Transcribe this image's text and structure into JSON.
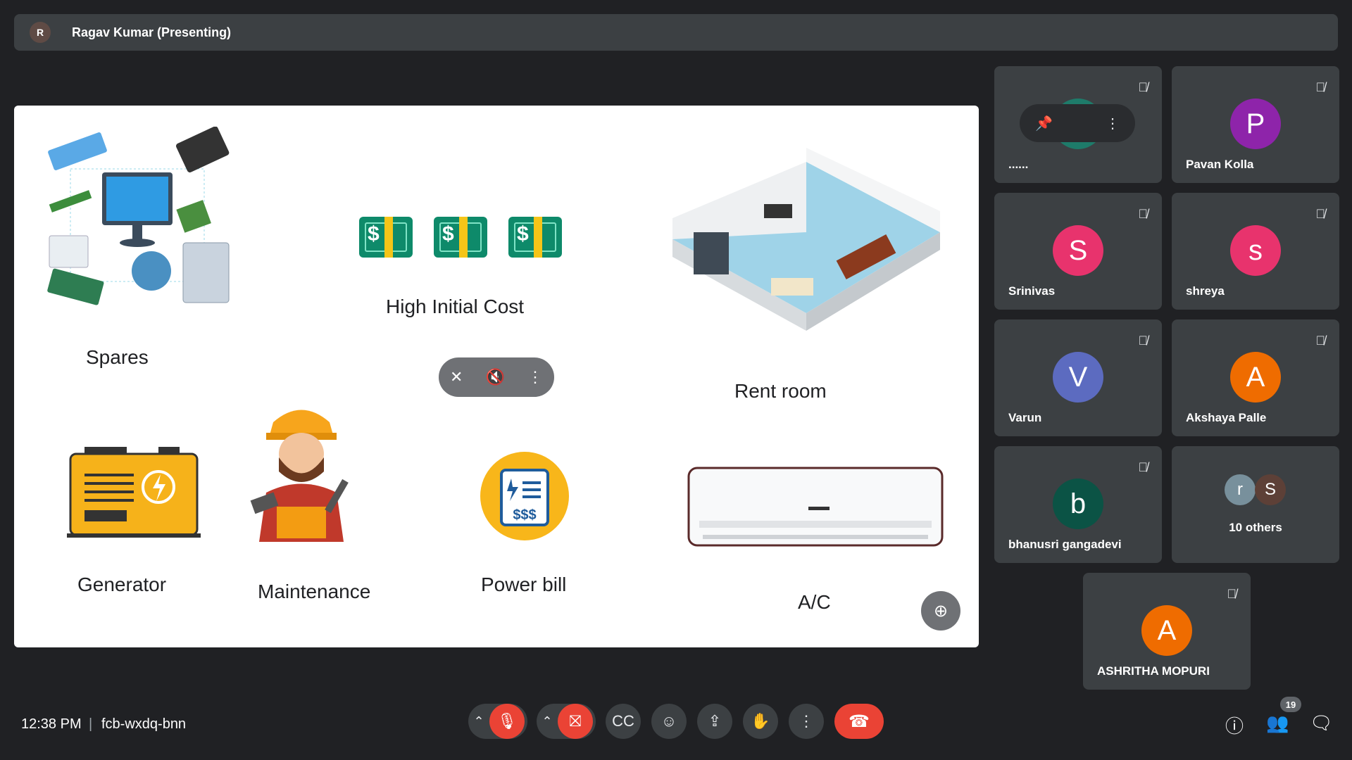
{
  "presenter": {
    "name": "Ragav Kumar (Presenting)",
    "avatar_initial": "R"
  },
  "slide": {
    "items": [
      {
        "label": "Spares"
      },
      {
        "label": "High Initial Cost"
      },
      {
        "label": "Rent room"
      },
      {
        "label": "Generator"
      },
      {
        "label": "Maintenance"
      },
      {
        "label": "Power bill"
      },
      {
        "label": "A/C"
      }
    ],
    "bills": [
      "$",
      "$",
      "$"
    ],
    "powerbill_text": "$$$"
  },
  "participants": [
    {
      "name": "......",
      "initial": "",
      "color": "#1e7b6a"
    },
    {
      "name": "Pavan Kolla",
      "initial": "P",
      "color": "#8e24aa"
    },
    {
      "name": "Srinivas",
      "initial": "S",
      "color": "#e8336d"
    },
    {
      "name": "shreya",
      "initial": "s",
      "color": "#e8336d"
    },
    {
      "name": "Varun",
      "initial": "V",
      "color": "#5c6bc0"
    },
    {
      "name": "Akshaya Palle",
      "initial": "A",
      "color": "#ef6c00"
    },
    {
      "name": "bhanusri gangadevi",
      "initial": "b",
      "color": "#0b5345"
    },
    {
      "name": "10 others",
      "initials": [
        "r",
        "S"
      ],
      "colors": [
        "#78909c",
        "#5d4037"
      ]
    },
    {
      "name": "ASHRITHA MOPURI",
      "initial": "A",
      "color": "#ef6c00"
    }
  ],
  "bottom": {
    "time": "12:38 PM",
    "separator": "|",
    "meeting_code": "fcb-wxdq-bnn",
    "people_count": "19"
  },
  "icons": {
    "mic_off": "mic-off-icon",
    "cam_off": "camera-off-icon",
    "captions": "captions-icon",
    "emoji": "emoji-icon",
    "present": "present-icon",
    "hand": "raise-hand-icon",
    "more": "more-vert-icon",
    "end": "end-call-icon",
    "info": "info-icon",
    "people": "people-icon",
    "chat": "chat-icon"
  }
}
